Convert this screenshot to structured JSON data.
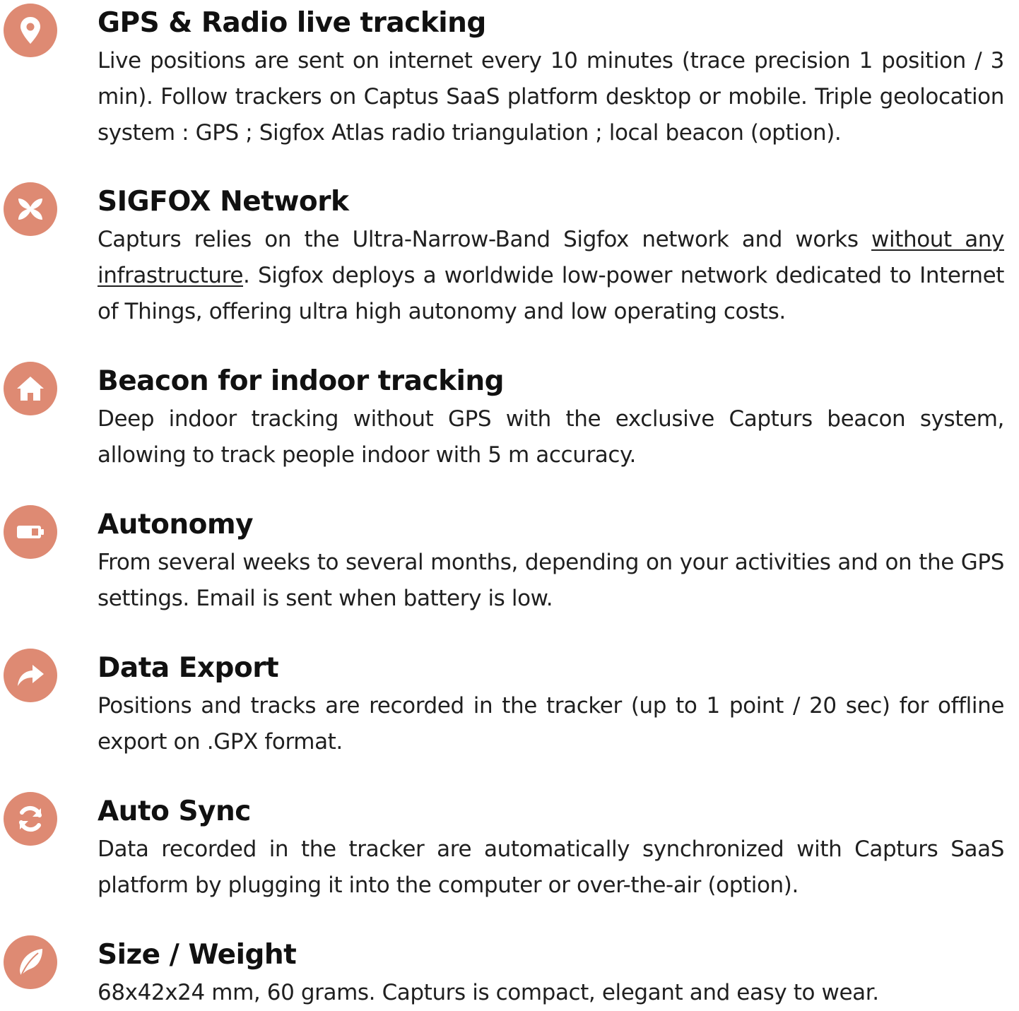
{
  "colors": {
    "icon_background": "#de8a73",
    "icon_glyph": "#ffffff",
    "title_text": "#111111",
    "body_text": "#1f1f1f"
  },
  "features": [
    {
      "icon": "map-pin-icon",
      "title": "GPS & Radio live tracking",
      "description": "Live positions are sent on internet every 10 minutes (trace precision 1 position / 3 min). Follow trackers on Captus SaaS platform desktop or mobile. Triple geolocation system : GPS ; Sigfox Atlas radio triangulation ; local beacon (option)."
    },
    {
      "icon": "sigfox-icon",
      "title": "SIGFOX Network",
      "description_before": "Capturs relies on the Ultra-Narrow-Band Sigfox network and works ",
      "description_link": "without any infrastructure",
      "description_after": ". Sigfox deploys a worldwide low-power network dedicated to Internet of Things, offering ultra high autonomy and low operating costs."
    },
    {
      "icon": "home-icon",
      "title": "Beacon for indoor tracking",
      "description": "Deep indoor tracking without GPS with the exclusive Capturs beacon system, allowing to track people indoor with 5 m accuracy."
    },
    {
      "icon": "battery-icon",
      "title": "Autonomy",
      "description": "From several weeks to several months, depending on your activities and on the GPS settings. Email is sent when battery is low."
    },
    {
      "icon": "share-arrow-icon",
      "title": "Data Export",
      "description": "Positions and tracks are recorded in the tracker (up to 1 point / 20 sec) for offline export on .GPX format."
    },
    {
      "icon": "sync-icon",
      "title": "Auto Sync",
      "description": "Data recorded in the tracker are automatically synchronized with Capturs SaaS platform by plugging it into the computer or over-the-air (option)."
    },
    {
      "icon": "feather-icon",
      "title": "Size / Weight",
      "description": "68x42x24 mm, 60 grams. Capturs is compact, elegant and easy to wear."
    }
  ]
}
